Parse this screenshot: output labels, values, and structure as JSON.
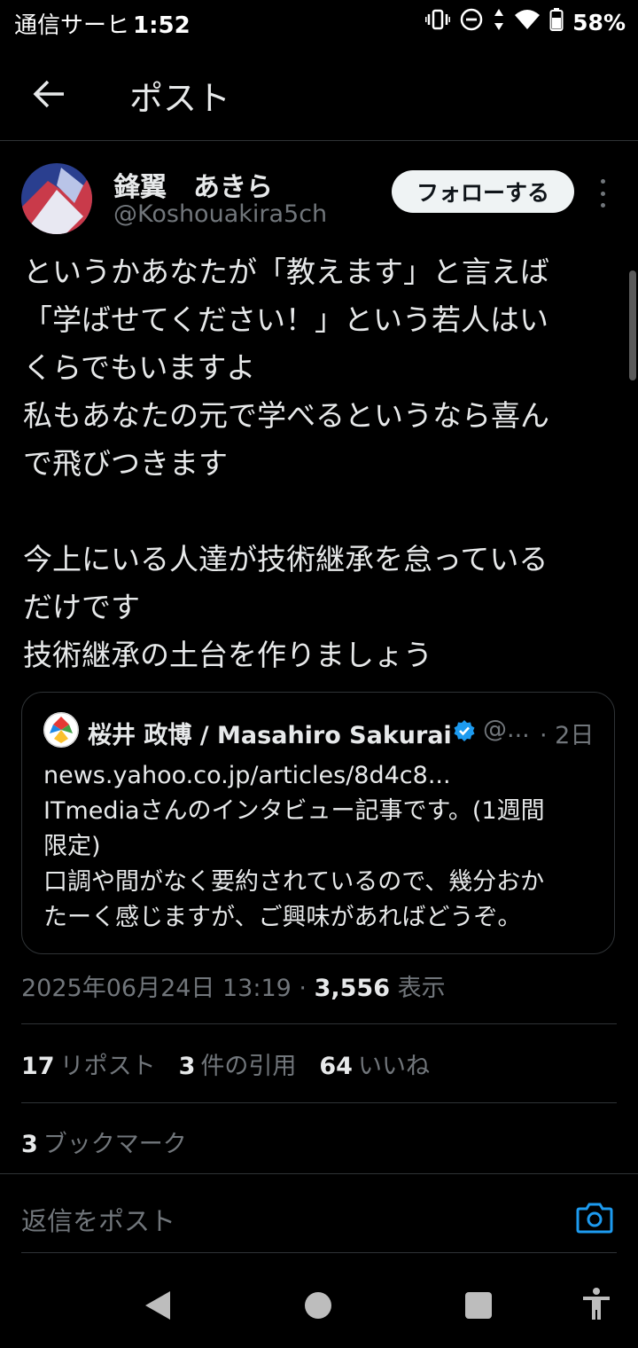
{
  "status_bar": {
    "carrier": "通信サーヒ",
    "time": "1:52",
    "battery": "58%"
  },
  "header": {
    "title": "ポスト"
  },
  "author": {
    "name": "鋒翼　あきら",
    "handle": "@Koshouakira5ch",
    "follow_label": "フォローする"
  },
  "post": {
    "lines": [
      "というかあなたが「教えます」と言えば",
      "「学ばせてください！」という若人はい",
      "くらでもいますよ",
      "私もあなたの元で学べるというなら喜ん",
      "で飛びつきます",
      "",
      "今上にいる人達が技術継承を怠っている",
      "だけです",
      "技術継承の土台を作りましょう"
    ]
  },
  "quote": {
    "name": "桜井 政博 / Masahiro Sakurai",
    "handle": "@...",
    "time": "· 2日",
    "lines": [
      "news.yahoo.co.jp/articles/8d4c8...",
      "ITmediaさんのインタビュー記事です。(1週間",
      "限定)",
      "口調や間がなく要約されているので、幾分おか",
      "たーく感じますが、ご興味があればどうぞ。"
    ]
  },
  "meta": {
    "datetime": "2025年06月24日 13:19 · ",
    "views_count": "3,556",
    "views_label": " 表示"
  },
  "stats": {
    "reposts_count": "17",
    "reposts_label": "リポスト",
    "quotes_count": "3",
    "quotes_label": "件の引用",
    "likes_count": "64",
    "likes_label": "いいね",
    "bookmarks_count": "3",
    "bookmarks_label": "ブックマーク"
  },
  "reply": {
    "placeholder": "返信をポスト"
  },
  "colors": {
    "background": "#000000",
    "text": "#e7e9ea",
    "muted": "#71767b",
    "accent": "#1d9bf0"
  }
}
